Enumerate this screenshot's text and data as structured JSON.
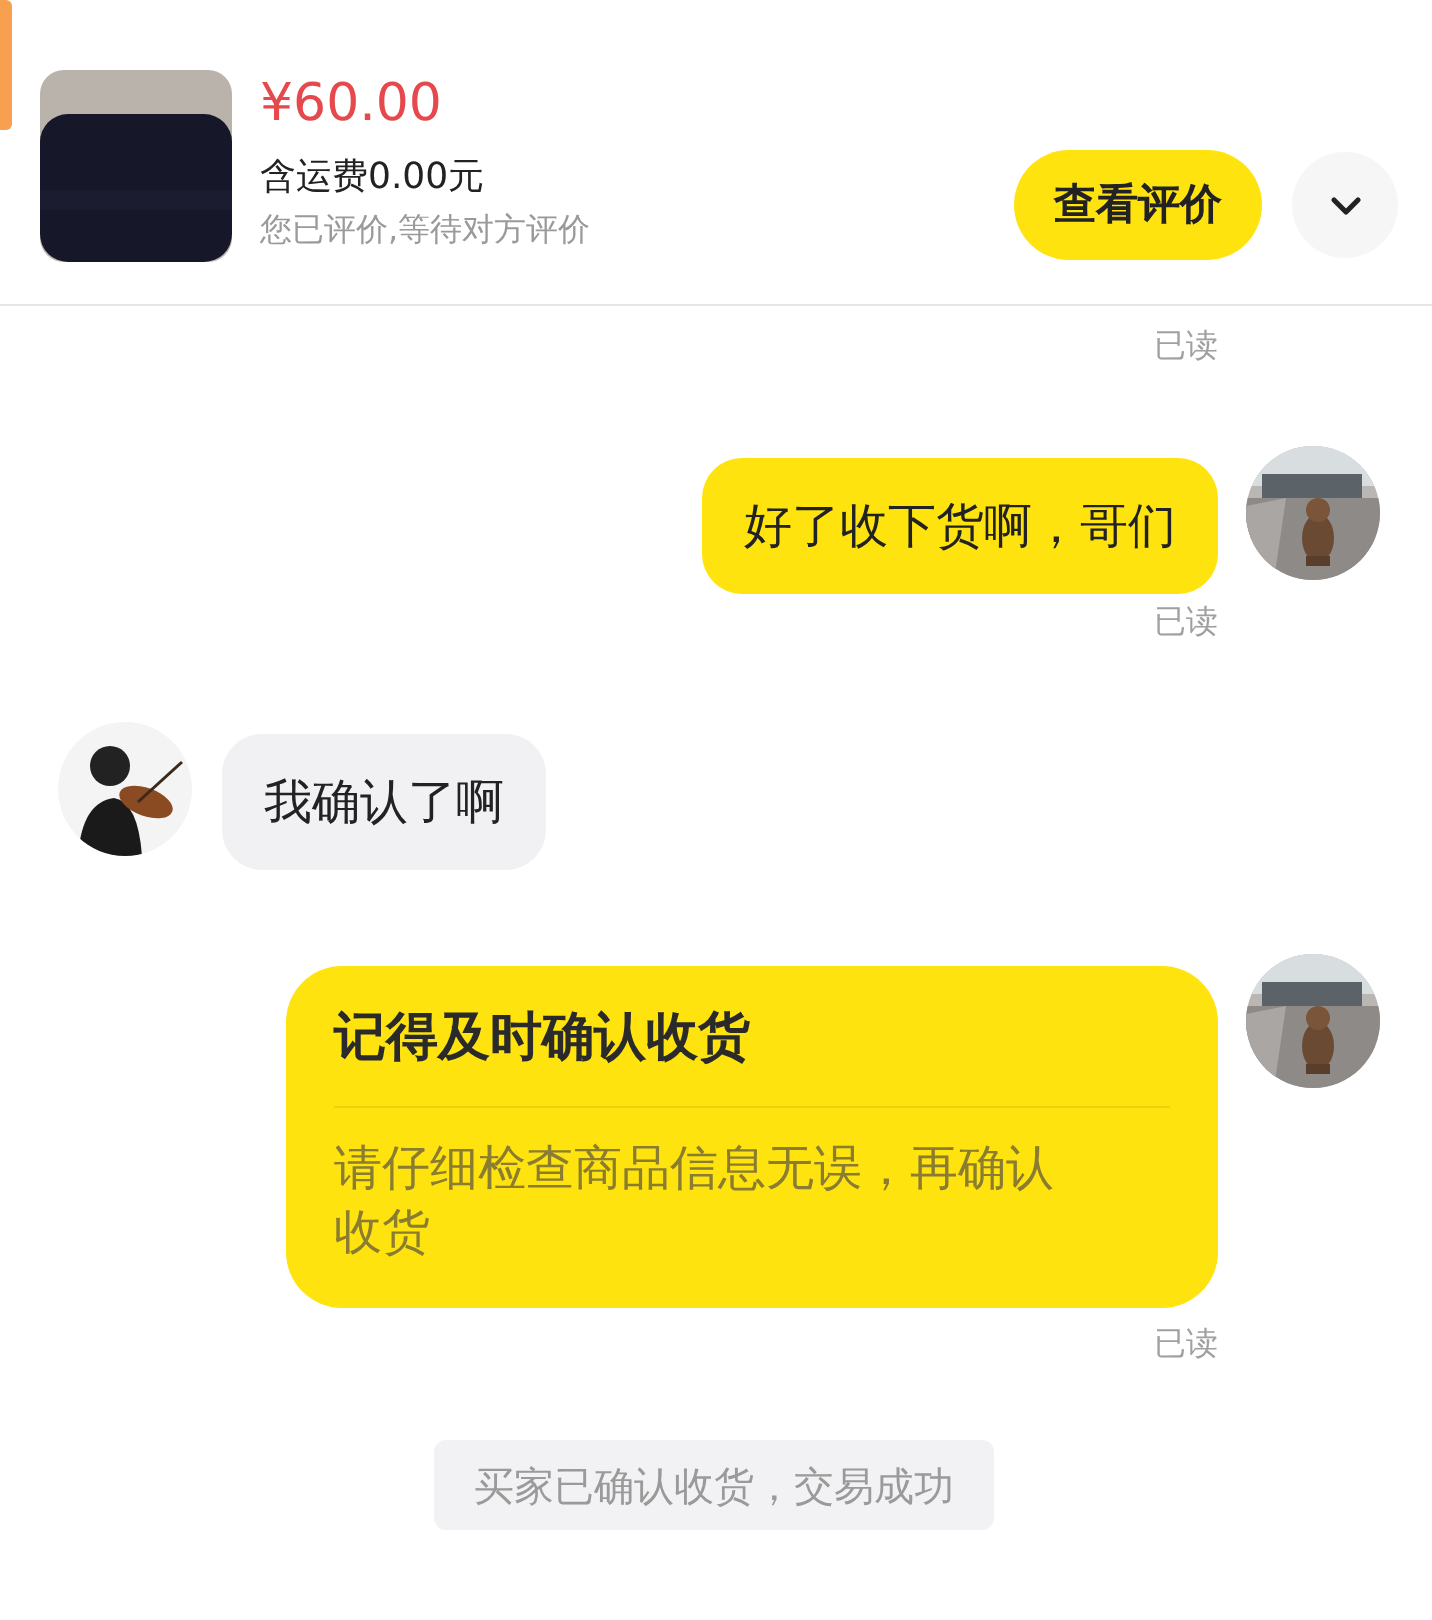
{
  "product": {
    "price": "¥60.00",
    "shipping": "含运费0.00元",
    "status": "您已评价,等待对方评价",
    "review_button": "查看评价",
    "expanded": false
  },
  "messages": [
    {
      "kind": "receipt",
      "text": "已读"
    },
    {
      "kind": "text",
      "outgoing": true,
      "text": "好了收下货啊，哥们"
    },
    {
      "kind": "receipt",
      "text": "已读"
    },
    {
      "kind": "text",
      "outgoing": false,
      "text": "我确认了啊"
    },
    {
      "kind": "card",
      "outgoing": true,
      "title": "记得及时确认收货",
      "body": "请仔细检查商品信息无误，再确认收货"
    },
    {
      "kind": "receipt",
      "text": "已读"
    },
    {
      "kind": "system",
      "text": "买家已确认收货，交易成功"
    }
  ]
}
